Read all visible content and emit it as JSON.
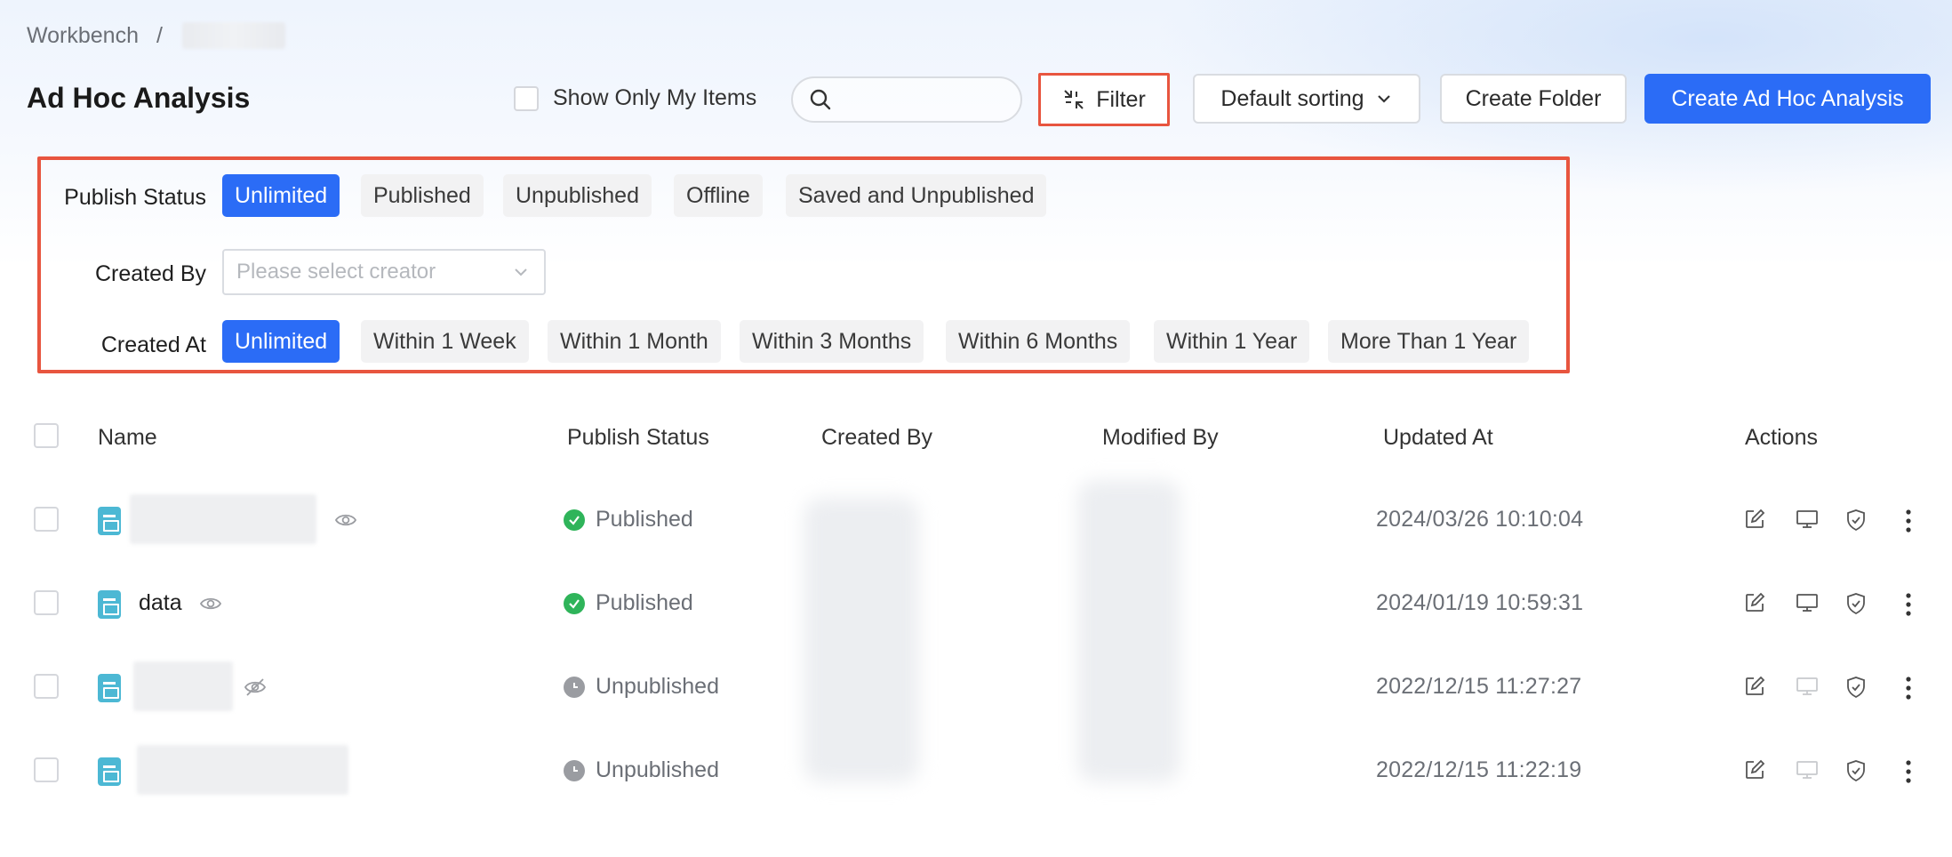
{
  "breadcrumb": {
    "root": "Workbench",
    "separator": "/"
  },
  "header": {
    "title": "Ad Hoc Analysis",
    "show_only_mine": "Show Only My Items",
    "search_placeholder": "",
    "filter_label": "Filter",
    "sort_label": "Default sorting",
    "create_folder": "Create Folder",
    "create_analysis": "Create Ad Hoc Analysis"
  },
  "filters": {
    "publish_status": {
      "label": "Publish Status",
      "options": [
        "Unlimited",
        "Published",
        "Unpublished",
        "Offline",
        "Saved and Unpublished"
      ],
      "selected": "Unlimited"
    },
    "created_by": {
      "label": "Created By",
      "placeholder": "Please select creator"
    },
    "created_at": {
      "label": "Created At",
      "options": [
        "Unlimited",
        "Within 1 Week",
        "Within 1 Month",
        "Within 3 Months",
        "Within 6 Months",
        "Within 1 Year",
        "More Than 1 Year"
      ],
      "selected": "Unlimited"
    }
  },
  "table": {
    "columns": [
      "Name",
      "Publish Status",
      "Created By",
      "Modified By",
      "Updated At",
      "Actions"
    ],
    "rows": [
      {
        "name": "",
        "status": "Published",
        "updated": "2024/03/26 10:10:04"
      },
      {
        "name": "data",
        "status": "Published",
        "updated": "2024/01/19 10:59:31"
      },
      {
        "name": "",
        "status": "Unpublished",
        "updated": "2022/12/15 11:27:27"
      },
      {
        "name": "",
        "status": "Unpublished",
        "updated": "2022/12/15 11:22:19"
      }
    ]
  },
  "colors": {
    "accent": "#2b6cf6",
    "highlight": "#e8553f",
    "published": "#2fb45a",
    "unpublished": "#9a9ca1",
    "file_icon": "#4cb8d4"
  }
}
